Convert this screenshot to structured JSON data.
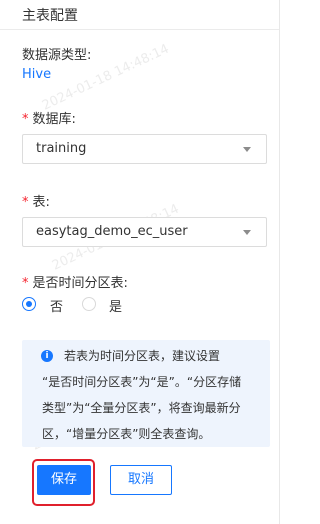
{
  "header": {
    "title": "主表配置"
  },
  "datasource": {
    "label": "数据源类型:",
    "value": "Hive"
  },
  "database": {
    "required_mark": "*",
    "label": "数据库:",
    "selected": "training"
  },
  "table": {
    "required_mark": "*",
    "label": "表:",
    "selected": "easytag_demo_ec_user"
  },
  "partition": {
    "required_mark": "*",
    "label": "是否时间分区表:",
    "options": [
      {
        "label": "否",
        "checked": true
      },
      {
        "label": "是",
        "checked": false
      }
    ]
  },
  "info": {
    "icon": "info-icon",
    "icon_glyph": "i",
    "lines": [
      "若表为时间分区表，建议设置",
      "“是否时间分区表”为“是”。“分区存储",
      "类型”为“全量分区表”，将查询最新分",
      "区，“增量分区表”则全表查询。"
    ]
  },
  "actions": {
    "save_label": "保存",
    "cancel_label": "取消"
  },
  "watermarks": [
    "2024-01-18 14:48:14",
    "2024-01-18 14:48:14",
    "2024-01-18 14:48:14"
  ],
  "colors": {
    "primary": "#1677ff",
    "required": "#f5222d",
    "highlight": "#e0202c",
    "info_bg": "#eef4fd"
  }
}
